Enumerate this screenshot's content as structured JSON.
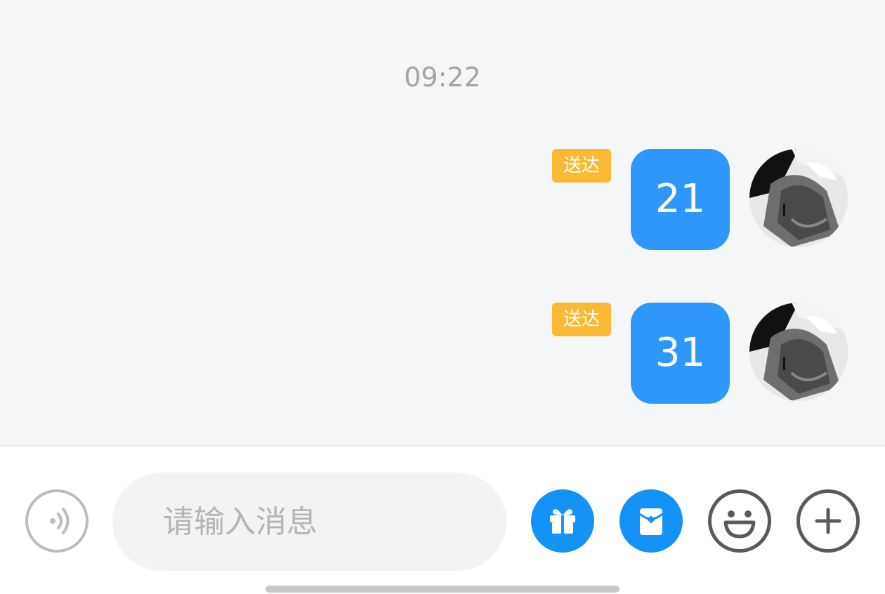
{
  "chat": {
    "timestamp": "09:22",
    "messages": [
      {
        "status": "送达",
        "text": "21"
      },
      {
        "status": "送达",
        "text": "31"
      }
    ]
  },
  "input_bar": {
    "placeholder": "请输入消息",
    "icons": [
      "voice-icon",
      "gift-icon",
      "red-packet-icon",
      "emoji-icon",
      "plus-icon"
    ]
  },
  "colors": {
    "bubble": "#2f96fa",
    "status_badge": "#f9b934",
    "accent_buttons": "#1492f5",
    "background": "#f5f6f8"
  }
}
